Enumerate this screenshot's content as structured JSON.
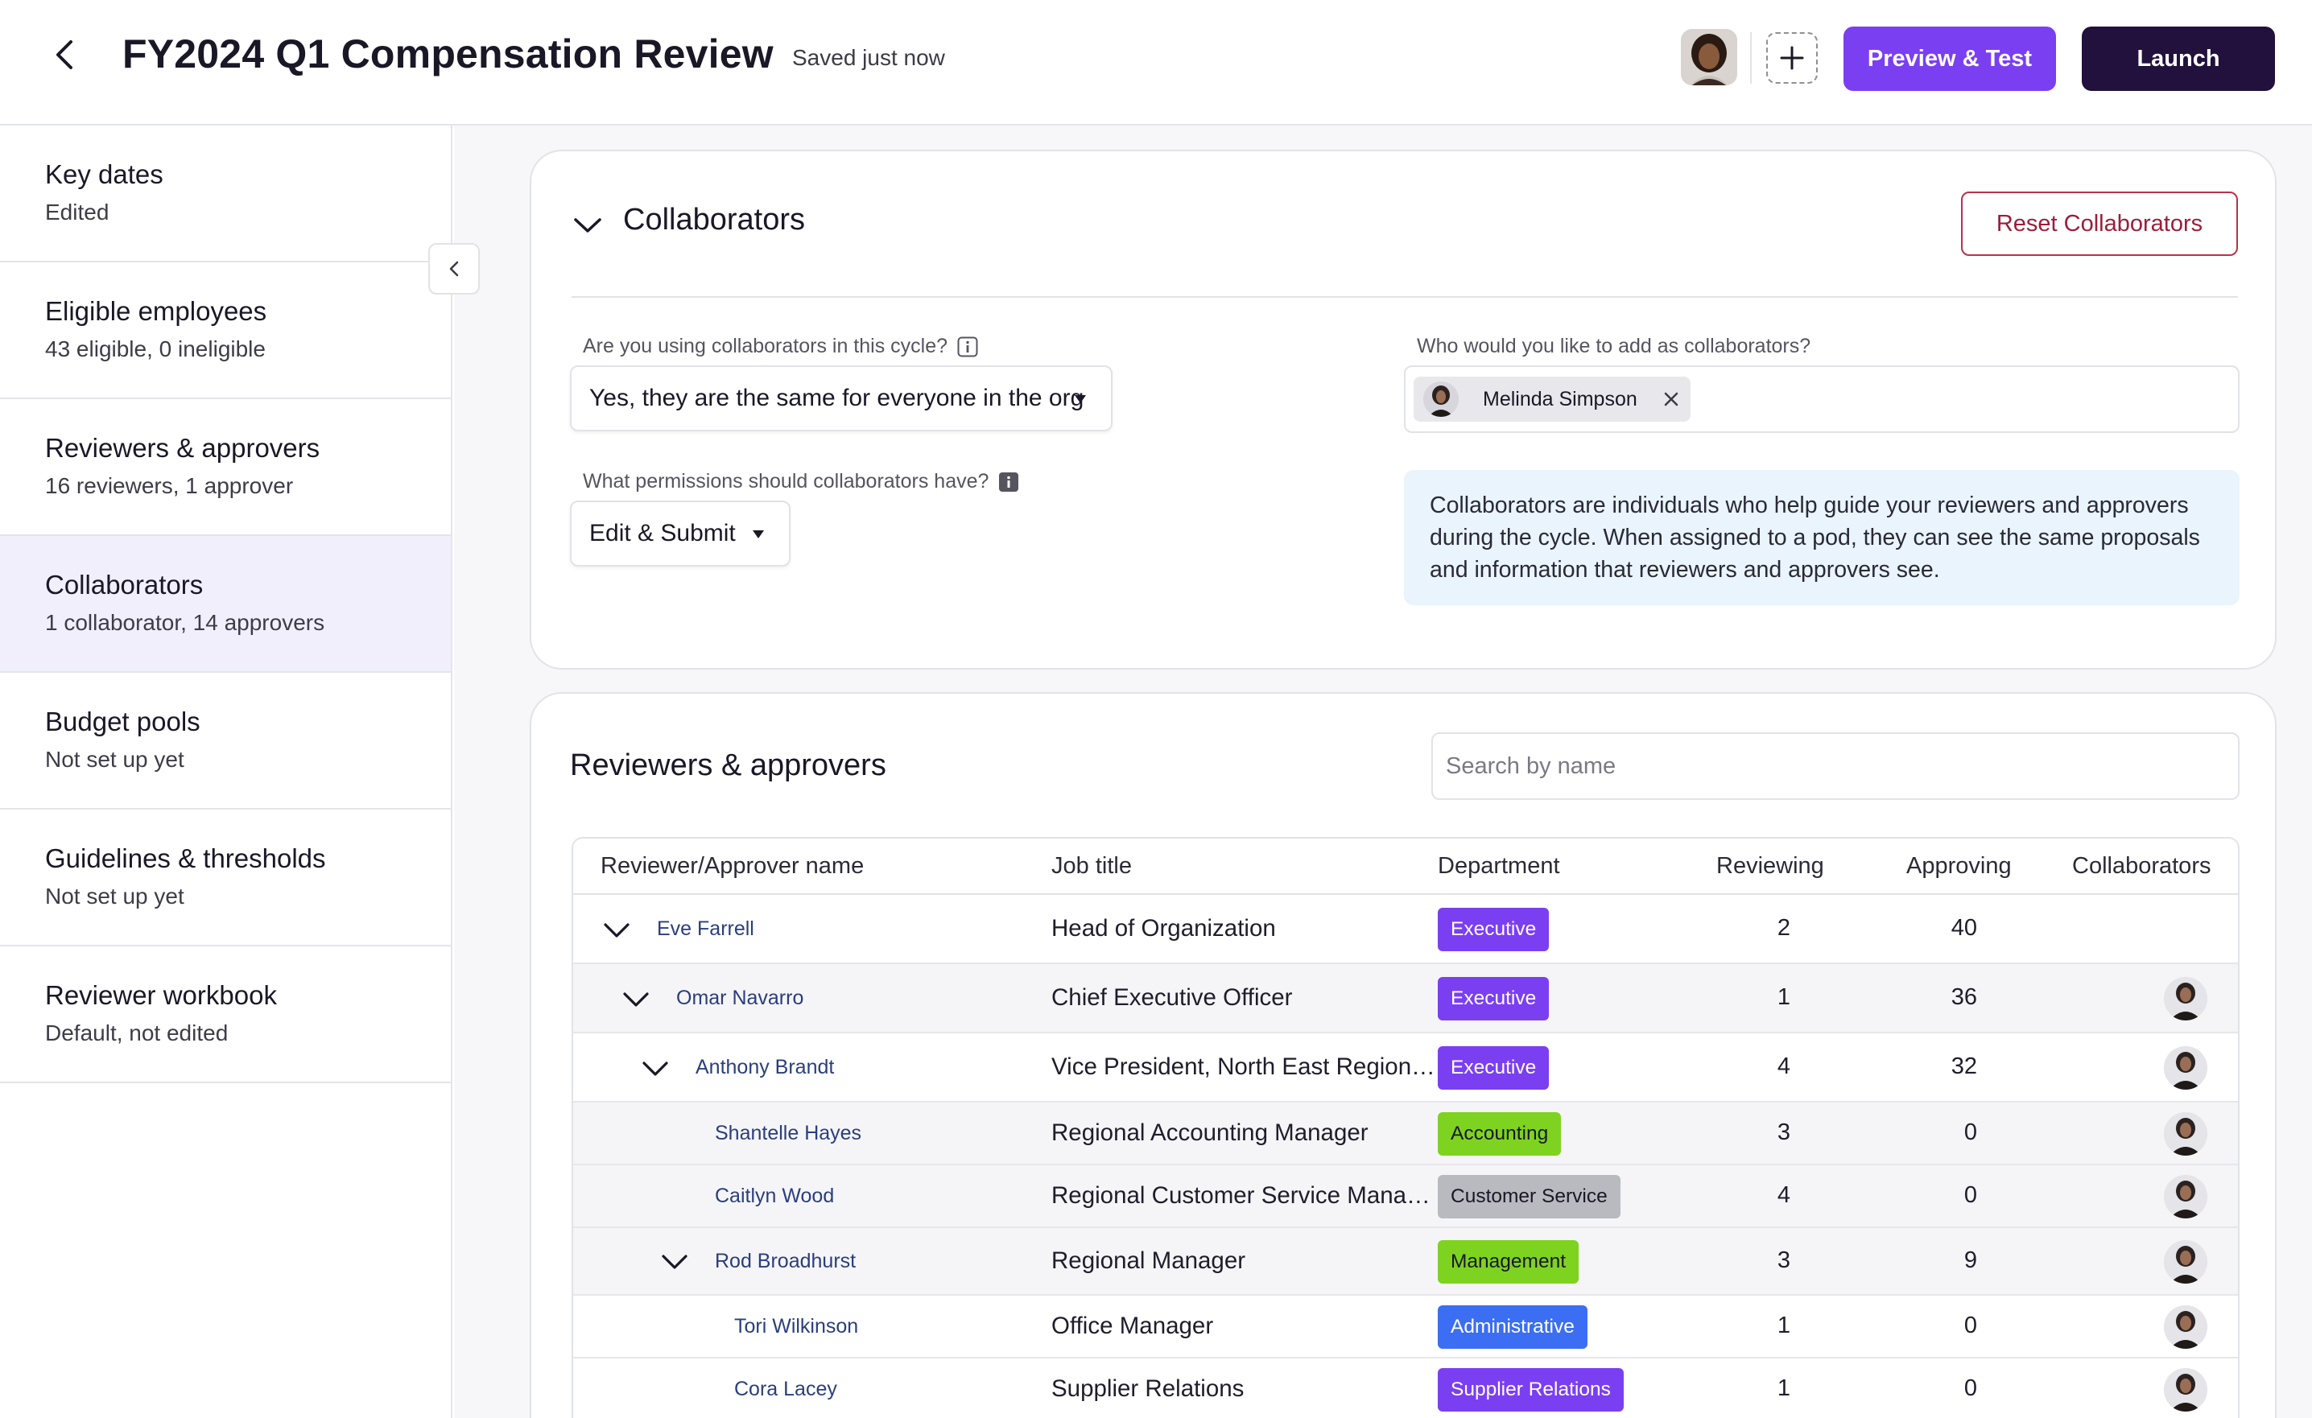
{
  "header": {
    "title": "FY2024 Q1 Compensation Review",
    "save_status": "Saved just now",
    "preview_label": "Preview & Test",
    "launch_label": "Launch"
  },
  "sidebar": {
    "items": [
      {
        "title": "Key dates",
        "subtitle": "Edited"
      },
      {
        "title": "Eligible employees",
        "subtitle": "43 eligible, 0 ineligible"
      },
      {
        "title": "Reviewers & approvers",
        "subtitle": "16 reviewers, 1 approver"
      },
      {
        "title": "Collaborators",
        "subtitle": "1 collaborator, 14 approvers"
      },
      {
        "title": "Budget pools",
        "subtitle": "Not set up yet"
      },
      {
        "title": "Guidelines & thresholds",
        "subtitle": "Not set up yet"
      },
      {
        "title": "Reviewer workbook",
        "subtitle": "Default, not edited"
      }
    ]
  },
  "collaborators_card": {
    "title": "Collaborators",
    "reset_label": "Reset Collaborators",
    "using_label": "Are you using collaborators in this cycle?",
    "using_value": "Yes, they are the same for everyone in the org",
    "permissions_label": "What permissions should collaborators have?",
    "permissions_value": "Edit & Submit",
    "who_label": "Who would you like to add as collaborators?",
    "chip_name": "Melinda Simpson",
    "info_text": "Collaborators are individuals who help guide your reviewers and approvers during the cycle. When assigned to a pod, they can see the same proposals and information that reviewers and approvers see."
  },
  "reviewers_card": {
    "title": "Reviewers & approvers",
    "search_placeholder": "Search by name",
    "columns": {
      "name": "Reviewer/Approver name",
      "job": "Job title",
      "dept": "Department",
      "reviewing": "Reviewing",
      "approving": "Approving",
      "collaborators": "Collaborators"
    },
    "rows": [
      {
        "name": "Eve Farrell",
        "job": "Head of Organization",
        "dept": "Executive",
        "reviewing": "2",
        "approving": "40"
      },
      {
        "name": "Omar Navarro",
        "job": "Chief Executive Officer",
        "dept": "Executive",
        "reviewing": "1",
        "approving": "36"
      },
      {
        "name": "Anthony Brandt",
        "job": "Vice President, North East Region &…",
        "dept": "Executive",
        "reviewing": "4",
        "approving": "32"
      },
      {
        "name": "Shantelle Hayes",
        "job": "Regional Accounting Manager",
        "dept": "Accounting",
        "reviewing": "3",
        "approving": "0"
      },
      {
        "name": "Caitlyn Wood",
        "job": "Regional Customer Service Manager",
        "dept": "Customer Service",
        "reviewing": "4",
        "approving": "0"
      },
      {
        "name": "Rod Broadhurst",
        "job": "Regional Manager",
        "dept": "Management",
        "reviewing": "3",
        "approving": "9"
      },
      {
        "name": "Tori Wilkinson",
        "job": "Office Manager",
        "dept": "Administrative",
        "reviewing": "1",
        "approving": "0"
      },
      {
        "name": "Cora Lacey",
        "job": "Supplier Relations",
        "dept": "Supplier Relations",
        "reviewing": "1",
        "approving": "0"
      }
    ]
  },
  "colors": {
    "primary": "#7b3ff2",
    "dark": "#22103d",
    "danger": "#9d1d3a",
    "executive": "#7b3ff2",
    "accounting": "#7ed321",
    "customer_service": "#b9b9c0",
    "management": "#7ed321",
    "administrative": "#3b6ef2",
    "supplier_relations": "#7b3ff2"
  }
}
